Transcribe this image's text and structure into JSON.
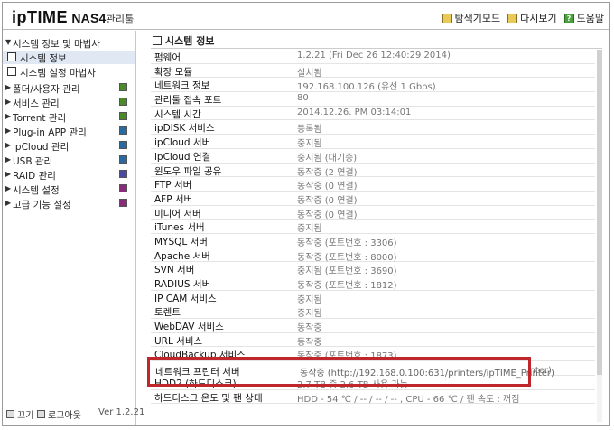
{
  "header": {
    "brand": "ipTIME",
    "model": "NAS4",
    "suffix": "관리툴",
    "links": [
      {
        "label": "탐색기모드",
        "icon": "explorer-icon"
      },
      {
        "label": "다시보기",
        "icon": "refresh-icon"
      },
      {
        "label": "도움말",
        "icon": "help-icon"
      }
    ],
    "help_glyph": "?"
  },
  "sidebar": {
    "items": [
      {
        "label": "시스템 정보 및 마법사",
        "expanded": true
      },
      {
        "label": "시스템 정보",
        "sub": true,
        "selected": true
      },
      {
        "label": "시스템 설정 마법사",
        "sub": true
      },
      {
        "label": "폴더/사용자 관리",
        "icon_color": "#4a8a2a"
      },
      {
        "label": "서비스 관리",
        "icon_color": "#4a8a2a"
      },
      {
        "label": "Torrent 관리",
        "icon_color": "#4a8a2a"
      },
      {
        "label": "Plug-in APP 관리",
        "icon_color": "#2a6aa0"
      },
      {
        "label": "ipCloud 관리",
        "icon_color": "#2a6aa0"
      },
      {
        "label": "USB 관리",
        "icon_color": "#2a6aa0"
      },
      {
        "label": "RAID 관리",
        "icon_color": "#4a4aa0"
      },
      {
        "label": "시스템 설정",
        "icon_color": "#8a2a7a"
      },
      {
        "label": "고급 기능 설정",
        "icon_color": "#8a2a7a"
      }
    ],
    "footer": {
      "off_label": "끄기",
      "logout_label": "로그아웃",
      "version": "Ver 1.2.21"
    }
  },
  "main": {
    "title": "시스템 정보",
    "rows": [
      {
        "key": "펌웨어",
        "value": "1.2.21 (Fri Dec 26 12:40:29 2014)"
      },
      {
        "key": "확장 모듈",
        "value": "설치됨"
      },
      {
        "key": "네트워크 정보",
        "value": "192.168.100.126 (유선 1 Gbps)"
      },
      {
        "key": "관리툴 접속 포트",
        "value": "80"
      },
      {
        "key": "시스템 시간",
        "value": "2014.12.26. PM 03:14:01"
      },
      {
        "key": "ipDISK 서비스",
        "value": "등록됨"
      },
      {
        "key": "ipCloud 서버",
        "value": "중지됨"
      },
      {
        "key": "ipCloud 연결",
        "value": "중지됨 (대기중)"
      },
      {
        "key": "윈도우 파일 공유",
        "value": "동작중 (2 연결)"
      },
      {
        "key": "FTP 서버",
        "value": "동작중 (0 연결)"
      },
      {
        "key": "AFP 서버",
        "value": "동작중 (0 연결)"
      },
      {
        "key": "미디어 서버",
        "value": "동작중 (0 연결)"
      },
      {
        "key": "iTunes 서버",
        "value": "중지됨"
      },
      {
        "key": "MYSQL 서버",
        "value": "동작중 (포트번호 : 3306)"
      },
      {
        "key": "Apache 서버",
        "value": "동작중 (포트번호 : 8000)"
      },
      {
        "key": "SVN 서버",
        "value": "중지됨 (포트번호 : 3690)"
      },
      {
        "key": "RADIUS 서버",
        "value": "동작중 (포트번호 : 1812)"
      },
      {
        "key": "IP CAM 서비스",
        "value": "중지됨"
      },
      {
        "key": "토렌트",
        "value": "중지됨"
      },
      {
        "key": "WebDAV 서비스",
        "value": "동작중"
      },
      {
        "key": "URL 서비스",
        "value": "동작중"
      },
      {
        "key": "CloudBackup 서비스",
        "value": "동작중 (포트번호 : 1873)"
      },
      {
        "key": "네트워크 프린터 서버",
        "value": "동작중 (http://192.168.0.100:631/printers/ipTIME_Printer)"
      },
      {
        "key": "HDD2 (하드디스크)",
        "value": "2.7 TB 중 2.6 TB 사용 가능"
      },
      {
        "key": "하드디스크 온도 및 팬 상태",
        "value": "HDD - 54 ℃ / -- / -- / -- , CPU - 66 ℃ / 팬 속도 : 꺼짐"
      }
    ],
    "highlighted": {
      "key": "네트워크 프린터 서버",
      "value": "동작중 (http://192.168.0.100:631/printers/ipTIME_Printer)",
      "color": "#c0272d"
    }
  }
}
